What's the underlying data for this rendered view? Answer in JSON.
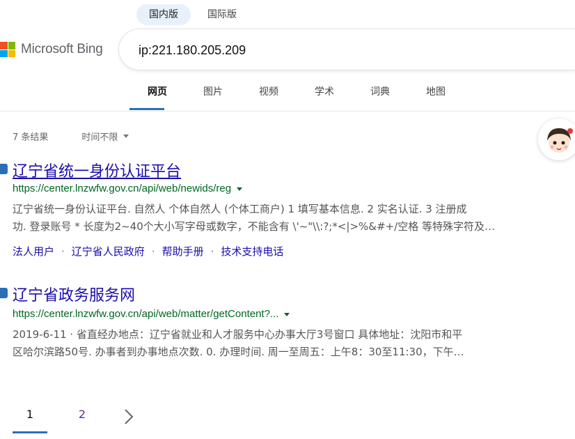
{
  "region_tabs": [
    {
      "label": "国内版",
      "active": true
    },
    {
      "label": "国际版",
      "active": false
    }
  ],
  "brand": {
    "name": "Microsoft Bing",
    "logo_colors": [
      "#f25022",
      "#7fba00",
      "#00a4ef",
      "#ffb900"
    ]
  },
  "search": {
    "query": "ip:221.180.205.209"
  },
  "scopes": [
    {
      "label": "网页",
      "active": true
    },
    {
      "label": "图片",
      "active": false
    },
    {
      "label": "视频",
      "active": false
    },
    {
      "label": "学术",
      "active": false
    },
    {
      "label": "词典",
      "active": false
    },
    {
      "label": "地图",
      "active": false
    }
  ],
  "results_meta": {
    "count_text": "7 条结果",
    "time_filter": "时间不限"
  },
  "results": [
    {
      "title": "辽宁省统一身份认证平台",
      "url": "https://center.lnzwfw.gov.cn/api/web/newids/reg",
      "snippet_lines": [
        "辽宁省统一身份认证平台. 自然人 个体自然人 (个体工商户) 1 填写基本信息. 2 实名认证. 3 注册成",
        "功. 登录账号 * 长度为2~40个大小写字母或数字，不能含有 \\'~\"\\\\:?;*<|>%&#+/空格 等特殊字符及…"
      ],
      "deeplinks": [
        "法人用户",
        "辽宁省人民政府",
        "帮助手册",
        "技术支持电话"
      ]
    },
    {
      "title": "辽宁省政务服务网",
      "url": "https://center.lnzwfw.gov.cn/api/web/matter/getContent?...",
      "snippet_lines": [
        "2019-6-11 · 省直经办地点：辽宁省就业和人才服务中心办事大厅3号窗口 具体地址：沈阳市和平",
        "区哈尔滨路50号. 办事者到办事地点次数. 0. 办理时间. 周一至周五：上午8：30至11:30，下午…"
      ]
    }
  ],
  "pagination": {
    "current": "1",
    "next_page": "2"
  },
  "colors": {
    "link": "#1a0dab",
    "url": "#006621",
    "accent": "#2a6eb8"
  }
}
